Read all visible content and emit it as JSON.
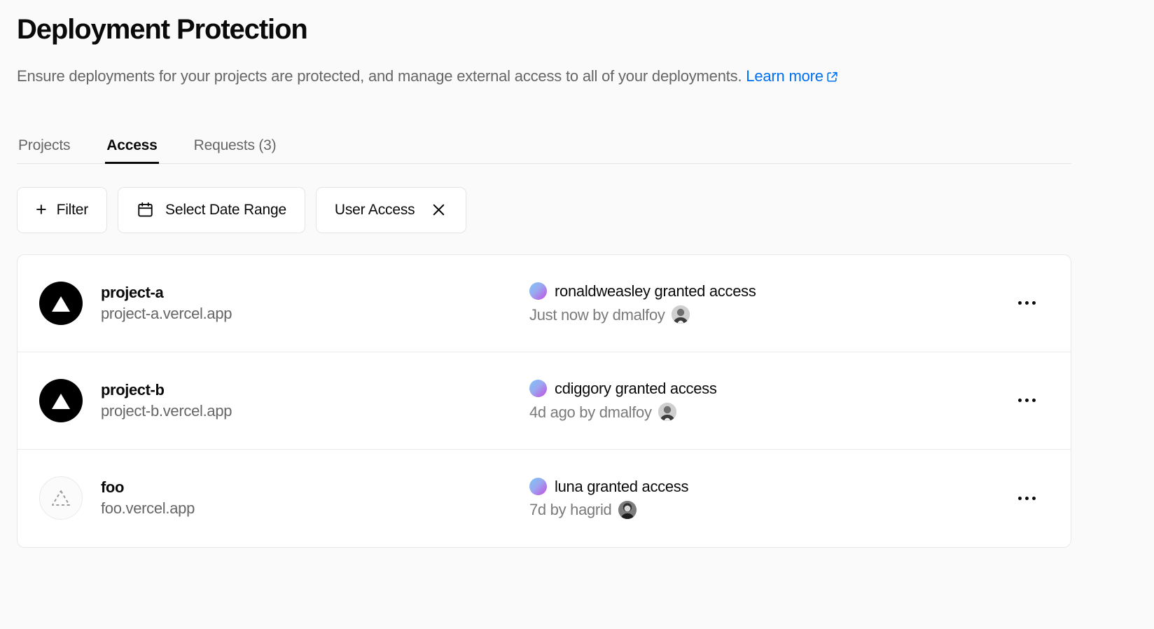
{
  "header": {
    "title": "Deployment Protection",
    "subtitle": "Ensure deployments for your projects are protected, and manage external access to all of your deployments.",
    "learn_more_label": "Learn more",
    "learn_more_icon": "external-link-icon",
    "link_color": "#0070f3"
  },
  "tabs": [
    {
      "label": "Projects",
      "active": false
    },
    {
      "label": "Access",
      "active": true
    },
    {
      "label": "Requests (3)",
      "active": false
    }
  ],
  "filters": {
    "add_filter_label": "Filter",
    "add_filter_icon": "plus-icon",
    "date_range_label": "Select Date Range",
    "date_range_icon": "calendar-icon",
    "active_filter_label": "User Access",
    "active_filter_remove_icon": "close-icon"
  },
  "rows": [
    {
      "project_name": "project-a",
      "project_domain": "project-a.vercel.app",
      "logo": "vercel-triangle-icon",
      "logo_style": "filled",
      "actor": "ronaldweasley",
      "action": "granted access",
      "activity": "ronaldweasley granted access",
      "meta": "Just now by dmalfoy",
      "meta_avatar": "dmalfoy-avatar",
      "menu_icon": "more-horizontal-icon"
    },
    {
      "project_name": "project-b",
      "project_domain": "project-b.vercel.app",
      "logo": "vercel-triangle-icon",
      "logo_style": "filled",
      "actor": "cdiggory",
      "action": "granted access",
      "activity": "cdiggory granted access",
      "meta": "4d ago by dmalfoy",
      "meta_avatar": "dmalfoy-avatar",
      "menu_icon": "more-horizontal-icon"
    },
    {
      "project_name": "foo",
      "project_domain": "foo.vercel.app",
      "logo": "dashed-triangle-icon",
      "logo_style": "ghost",
      "actor": "luna",
      "action": "granted access",
      "activity": "luna granted access",
      "meta": "7d by hagrid",
      "meta_avatar": "hagrid-avatar",
      "menu_icon": "more-horizontal-icon"
    }
  ],
  "colors": {
    "page_background": "#fafafa",
    "card_background": "#ffffff",
    "border": "#e5e5e5",
    "text_primary": "#0a0a0a",
    "text_secondary": "#666666",
    "accent_link": "#0070f3"
  }
}
